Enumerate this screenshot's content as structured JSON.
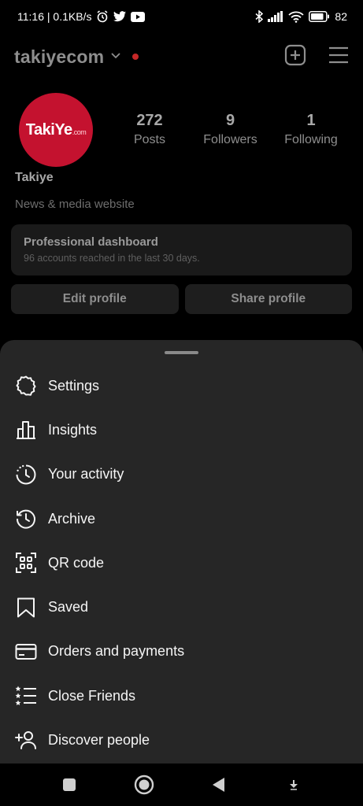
{
  "status_bar": {
    "time_speed": "11:16 | 0.1KB/s",
    "battery": "82"
  },
  "header": {
    "username": "takiyecom"
  },
  "profile": {
    "avatar_logo_main": "TakiYe",
    "avatar_logo_suffix": ".com",
    "stats": [
      {
        "value": "272",
        "label": "Posts"
      },
      {
        "value": "9",
        "label": "Followers"
      },
      {
        "value": "1",
        "label": "Following"
      }
    ],
    "name": "Takiye",
    "category": "News & media website"
  },
  "dashboard": {
    "title": "Professional dashboard",
    "subtitle": "96 accounts reached in the last 30 days."
  },
  "buttons": {
    "edit_profile": "Edit profile",
    "share_profile": "Share profile"
  },
  "menu": {
    "items": [
      {
        "label": "Settings",
        "icon": "gear-icon"
      },
      {
        "label": "Insights",
        "icon": "bar-chart-icon"
      },
      {
        "label": "Your activity",
        "icon": "activity-clock-icon"
      },
      {
        "label": "Archive",
        "icon": "archive-clock-icon"
      },
      {
        "label": "QR code",
        "icon": "qr-code-icon"
      },
      {
        "label": "Saved",
        "icon": "bookmark-icon"
      },
      {
        "label": "Orders and payments",
        "icon": "credit-card-icon"
      },
      {
        "label": "Close Friends",
        "icon": "star-list-icon"
      },
      {
        "label": "Discover people",
        "icon": "add-person-icon"
      }
    ]
  },
  "colors": {
    "accent_red": "#c4122f",
    "sheet_bg": "#262626"
  }
}
